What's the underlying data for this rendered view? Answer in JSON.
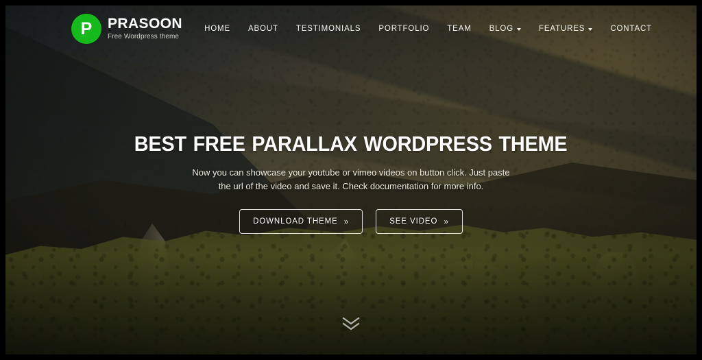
{
  "brand": {
    "logo_letter": "P",
    "name": "PRASOON",
    "tagline": "Free Wordpress theme",
    "logo_color": "#17ba1c"
  },
  "nav": {
    "items": [
      {
        "label": "HOME",
        "has_dropdown": false
      },
      {
        "label": "ABOUT",
        "has_dropdown": false
      },
      {
        "label": "TESTIMONIALS",
        "has_dropdown": false
      },
      {
        "label": "PORTFOLIO",
        "has_dropdown": false
      },
      {
        "label": "TEAM",
        "has_dropdown": false
      },
      {
        "label": "BLOG",
        "has_dropdown": true
      },
      {
        "label": "FEATURES",
        "has_dropdown": true
      },
      {
        "label": "CONTACT",
        "has_dropdown": false
      }
    ]
  },
  "hero": {
    "title": "BEST FREE PARALLAX WORDPRESS THEME",
    "subtitle": "Now you can showcase your youtube or vimeo videos on button click. Just paste the url of the video and save it. Check documentation for more info.",
    "buttons": [
      {
        "label": "DOWNLOAD THEME",
        "chevron": "»"
      },
      {
        "label": "SEE VIDEO",
        "chevron": "»"
      }
    ],
    "scroll_indicator": "chevron-down-icon",
    "text_color": "#ffffff"
  },
  "background": {
    "scene": "mountain-landscape-photo",
    "sky_top": "#3c4247",
    "haze_warm": "#6b6245",
    "moss_green": "#606424",
    "rock_brown": "#605841",
    "frame_color": "#000000"
  }
}
